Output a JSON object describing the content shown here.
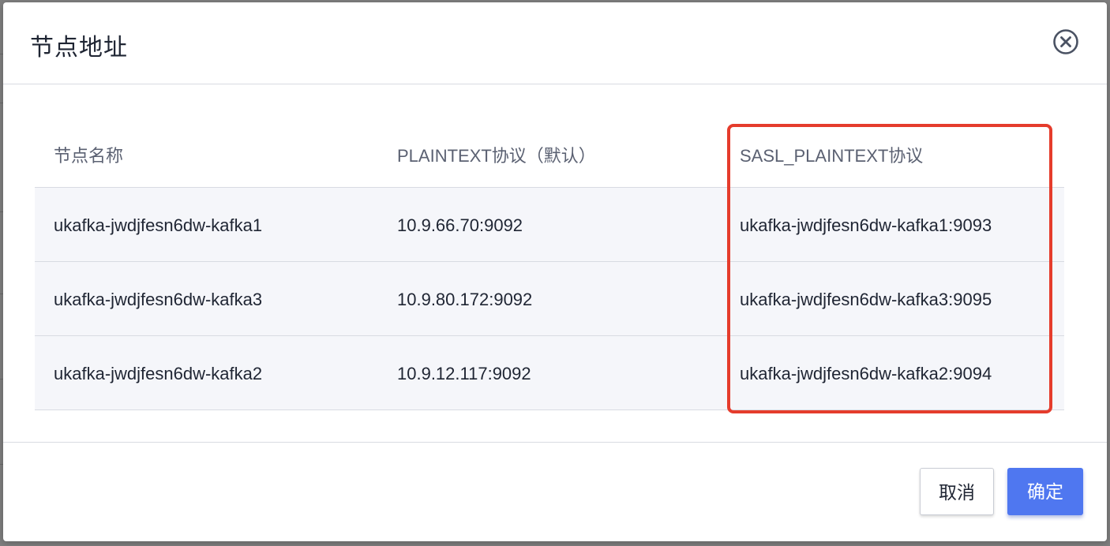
{
  "dialog": {
    "title": "节点地址",
    "close_icon": "close-circle-icon"
  },
  "table": {
    "headers": [
      "节点名称",
      "PLAINTEXT协议（默认）",
      "SASL_PLAINTEXT协议"
    ],
    "rows": [
      [
        "ukafka-jwdjfesn6dw-kafka1",
        "10.9.66.70:9092",
        "ukafka-jwdjfesn6dw-kafka1:9093"
      ],
      [
        "ukafka-jwdjfesn6dw-kafka3",
        "10.9.80.172:9092",
        "ukafka-jwdjfesn6dw-kafka3:9095"
      ],
      [
        "ukafka-jwdjfesn6dw-kafka2",
        "10.9.12.117:9092",
        "ukafka-jwdjfesn6dw-kafka2:9094"
      ]
    ]
  },
  "footer": {
    "cancel_label": "取消",
    "confirm_label": "确定"
  },
  "colors": {
    "primary": "#4f77f0",
    "highlight": "#e53c2c",
    "row_bg": "#f5f6fa"
  }
}
